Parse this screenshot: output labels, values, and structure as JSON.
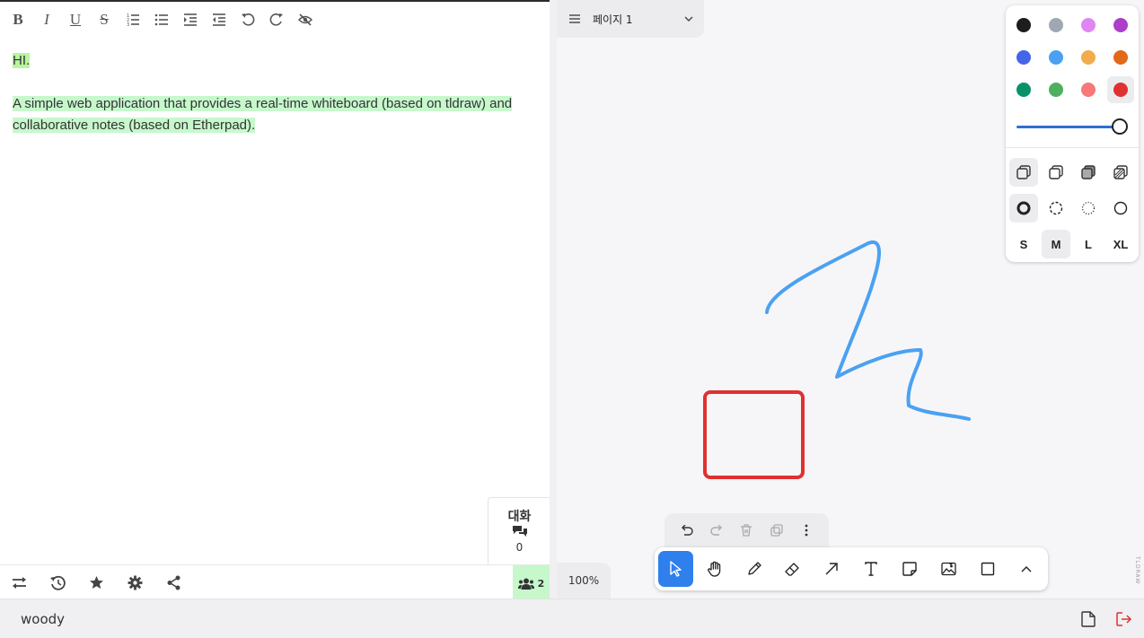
{
  "editor": {
    "toolbar": {
      "bold": "B",
      "italic": "I",
      "underline": "U",
      "strikethrough": "S"
    },
    "content": {
      "line1": "HI.",
      "paragraph": "A simple web application that provides a real-time whiteboard (based on tldraw) and collaborative notes (based on Etherpad)."
    },
    "chat": {
      "label": "대화",
      "count": "0"
    },
    "users_count": "2"
  },
  "whiteboard": {
    "page_name": "페이지 1",
    "zoom": "100%",
    "watermark": "TLDRAW",
    "colors": [
      "#1d1d1d",
      "#9fa8b2",
      "#e085f4",
      "#ae3ec9",
      "#4465e9",
      "#4ba1f1",
      "#f1ac4b",
      "#e16919",
      "#099268",
      "#4cb05e",
      "#f87777",
      "#e03131"
    ],
    "selected_color": "#e03131",
    "opacity": 1.0,
    "size_options": [
      "S",
      "M",
      "L",
      "XL"
    ],
    "selected_size": "M",
    "shapes": {
      "squiggle_color": "#4ba1f1",
      "rectangle_color": "#e03131"
    }
  },
  "statusbar": {
    "username": "woody"
  }
}
